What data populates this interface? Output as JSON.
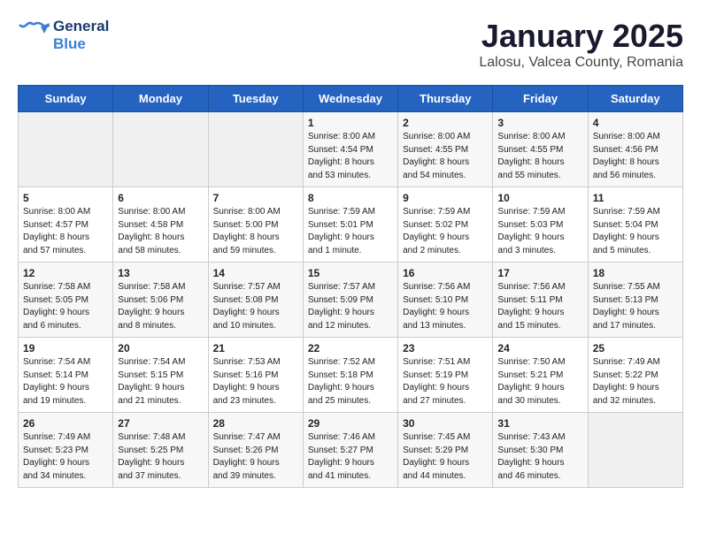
{
  "header": {
    "logo_line1": "General",
    "logo_line2": "Blue",
    "title": "January 2025",
    "subtitle": "Lalosu, Valcea County, Romania"
  },
  "weekdays": [
    "Sunday",
    "Monday",
    "Tuesday",
    "Wednesday",
    "Thursday",
    "Friday",
    "Saturday"
  ],
  "weeks": [
    [
      {
        "day": "",
        "info": ""
      },
      {
        "day": "",
        "info": ""
      },
      {
        "day": "",
        "info": ""
      },
      {
        "day": "1",
        "info": "Sunrise: 8:00 AM\nSunset: 4:54 PM\nDaylight: 8 hours\nand 53 minutes."
      },
      {
        "day": "2",
        "info": "Sunrise: 8:00 AM\nSunset: 4:55 PM\nDaylight: 8 hours\nand 54 minutes."
      },
      {
        "day": "3",
        "info": "Sunrise: 8:00 AM\nSunset: 4:55 PM\nDaylight: 8 hours\nand 55 minutes."
      },
      {
        "day": "4",
        "info": "Sunrise: 8:00 AM\nSunset: 4:56 PM\nDaylight: 8 hours\nand 56 minutes."
      }
    ],
    [
      {
        "day": "5",
        "info": "Sunrise: 8:00 AM\nSunset: 4:57 PM\nDaylight: 8 hours\nand 57 minutes."
      },
      {
        "day": "6",
        "info": "Sunrise: 8:00 AM\nSunset: 4:58 PM\nDaylight: 8 hours\nand 58 minutes."
      },
      {
        "day": "7",
        "info": "Sunrise: 8:00 AM\nSunset: 5:00 PM\nDaylight: 8 hours\nand 59 minutes."
      },
      {
        "day": "8",
        "info": "Sunrise: 7:59 AM\nSunset: 5:01 PM\nDaylight: 9 hours\nand 1 minute."
      },
      {
        "day": "9",
        "info": "Sunrise: 7:59 AM\nSunset: 5:02 PM\nDaylight: 9 hours\nand 2 minutes."
      },
      {
        "day": "10",
        "info": "Sunrise: 7:59 AM\nSunset: 5:03 PM\nDaylight: 9 hours\nand 3 minutes."
      },
      {
        "day": "11",
        "info": "Sunrise: 7:59 AM\nSunset: 5:04 PM\nDaylight: 9 hours\nand 5 minutes."
      }
    ],
    [
      {
        "day": "12",
        "info": "Sunrise: 7:58 AM\nSunset: 5:05 PM\nDaylight: 9 hours\nand 6 minutes."
      },
      {
        "day": "13",
        "info": "Sunrise: 7:58 AM\nSunset: 5:06 PM\nDaylight: 9 hours\nand 8 minutes."
      },
      {
        "day": "14",
        "info": "Sunrise: 7:57 AM\nSunset: 5:08 PM\nDaylight: 9 hours\nand 10 minutes."
      },
      {
        "day": "15",
        "info": "Sunrise: 7:57 AM\nSunset: 5:09 PM\nDaylight: 9 hours\nand 12 minutes."
      },
      {
        "day": "16",
        "info": "Sunrise: 7:56 AM\nSunset: 5:10 PM\nDaylight: 9 hours\nand 13 minutes."
      },
      {
        "day": "17",
        "info": "Sunrise: 7:56 AM\nSunset: 5:11 PM\nDaylight: 9 hours\nand 15 minutes."
      },
      {
        "day": "18",
        "info": "Sunrise: 7:55 AM\nSunset: 5:13 PM\nDaylight: 9 hours\nand 17 minutes."
      }
    ],
    [
      {
        "day": "19",
        "info": "Sunrise: 7:54 AM\nSunset: 5:14 PM\nDaylight: 9 hours\nand 19 minutes."
      },
      {
        "day": "20",
        "info": "Sunrise: 7:54 AM\nSunset: 5:15 PM\nDaylight: 9 hours\nand 21 minutes."
      },
      {
        "day": "21",
        "info": "Sunrise: 7:53 AM\nSunset: 5:16 PM\nDaylight: 9 hours\nand 23 minutes."
      },
      {
        "day": "22",
        "info": "Sunrise: 7:52 AM\nSunset: 5:18 PM\nDaylight: 9 hours\nand 25 minutes."
      },
      {
        "day": "23",
        "info": "Sunrise: 7:51 AM\nSunset: 5:19 PM\nDaylight: 9 hours\nand 27 minutes."
      },
      {
        "day": "24",
        "info": "Sunrise: 7:50 AM\nSunset: 5:21 PM\nDaylight: 9 hours\nand 30 minutes."
      },
      {
        "day": "25",
        "info": "Sunrise: 7:49 AM\nSunset: 5:22 PM\nDaylight: 9 hours\nand 32 minutes."
      }
    ],
    [
      {
        "day": "26",
        "info": "Sunrise: 7:49 AM\nSunset: 5:23 PM\nDaylight: 9 hours\nand 34 minutes."
      },
      {
        "day": "27",
        "info": "Sunrise: 7:48 AM\nSunset: 5:25 PM\nDaylight: 9 hours\nand 37 minutes."
      },
      {
        "day": "28",
        "info": "Sunrise: 7:47 AM\nSunset: 5:26 PM\nDaylight: 9 hours\nand 39 minutes."
      },
      {
        "day": "29",
        "info": "Sunrise: 7:46 AM\nSunset: 5:27 PM\nDaylight: 9 hours\nand 41 minutes."
      },
      {
        "day": "30",
        "info": "Sunrise: 7:45 AM\nSunset: 5:29 PM\nDaylight: 9 hours\nand 44 minutes."
      },
      {
        "day": "31",
        "info": "Sunrise: 7:43 AM\nSunset: 5:30 PM\nDaylight: 9 hours\nand 46 minutes."
      },
      {
        "day": "",
        "info": ""
      }
    ]
  ]
}
